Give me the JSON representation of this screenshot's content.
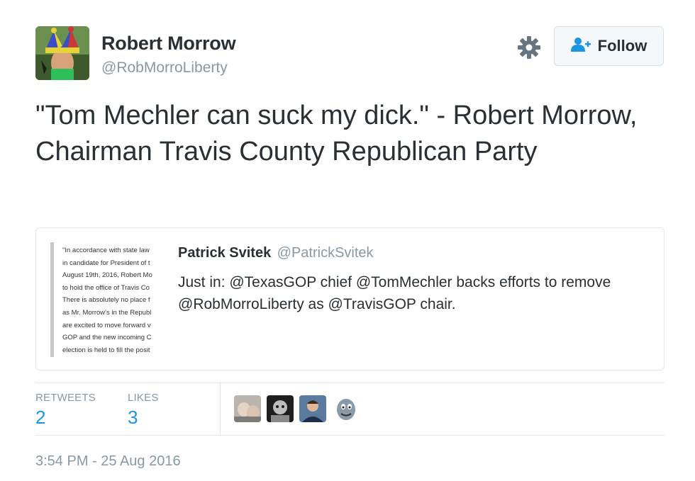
{
  "tweet": {
    "author": {
      "display_name": "Robert Morrow",
      "screen_name": "@RobMorroLiberty",
      "avatar_icon": "jester-hat-avatar"
    },
    "actions": {
      "settings_icon": "gear-icon",
      "follow_icon": "add-user-icon",
      "follow_label": "Follow"
    },
    "text": "\"Tom Mechler can suck my dick.\" - Robert Morrow, Chairman Travis County Republican Party",
    "quoted": {
      "author_name": "Patrick Svitek",
      "author_handle": "@PatrickSvitek",
      "text": "Just in: @TexasGOP chief @TomMechler backs efforts to remove @RobMorroLiberty as @TravisGOP chair.",
      "media_lines": [
        "\"In accordance with state law",
        "in candidate for President of t",
        "August 19th, 2016, Robert Mo",
        "to hold the office of Travis Co",
        "There is absolutely no place f",
        "as Mr. Morrow's in the Republ",
        "are excited to move forward v",
        "GOP and the new incoming C",
        "election is held to fill the posit"
      ]
    },
    "stats": {
      "retweets_label": "RETWEETS",
      "retweets_count": "2",
      "likes_label": "LIKES",
      "likes_count": "3"
    },
    "likers": [
      {
        "name": "liker-avatar-1"
      },
      {
        "name": "liker-avatar-2"
      },
      {
        "name": "liker-avatar-3"
      },
      {
        "name": "liker-avatar-4"
      }
    ],
    "timestamp": "3:54 PM - 25 Aug 2016"
  },
  "colors": {
    "link_blue": "#1b95e0",
    "muted_gray": "#8899a6",
    "text_dark": "#292f33",
    "border": "#e1e8ed"
  }
}
